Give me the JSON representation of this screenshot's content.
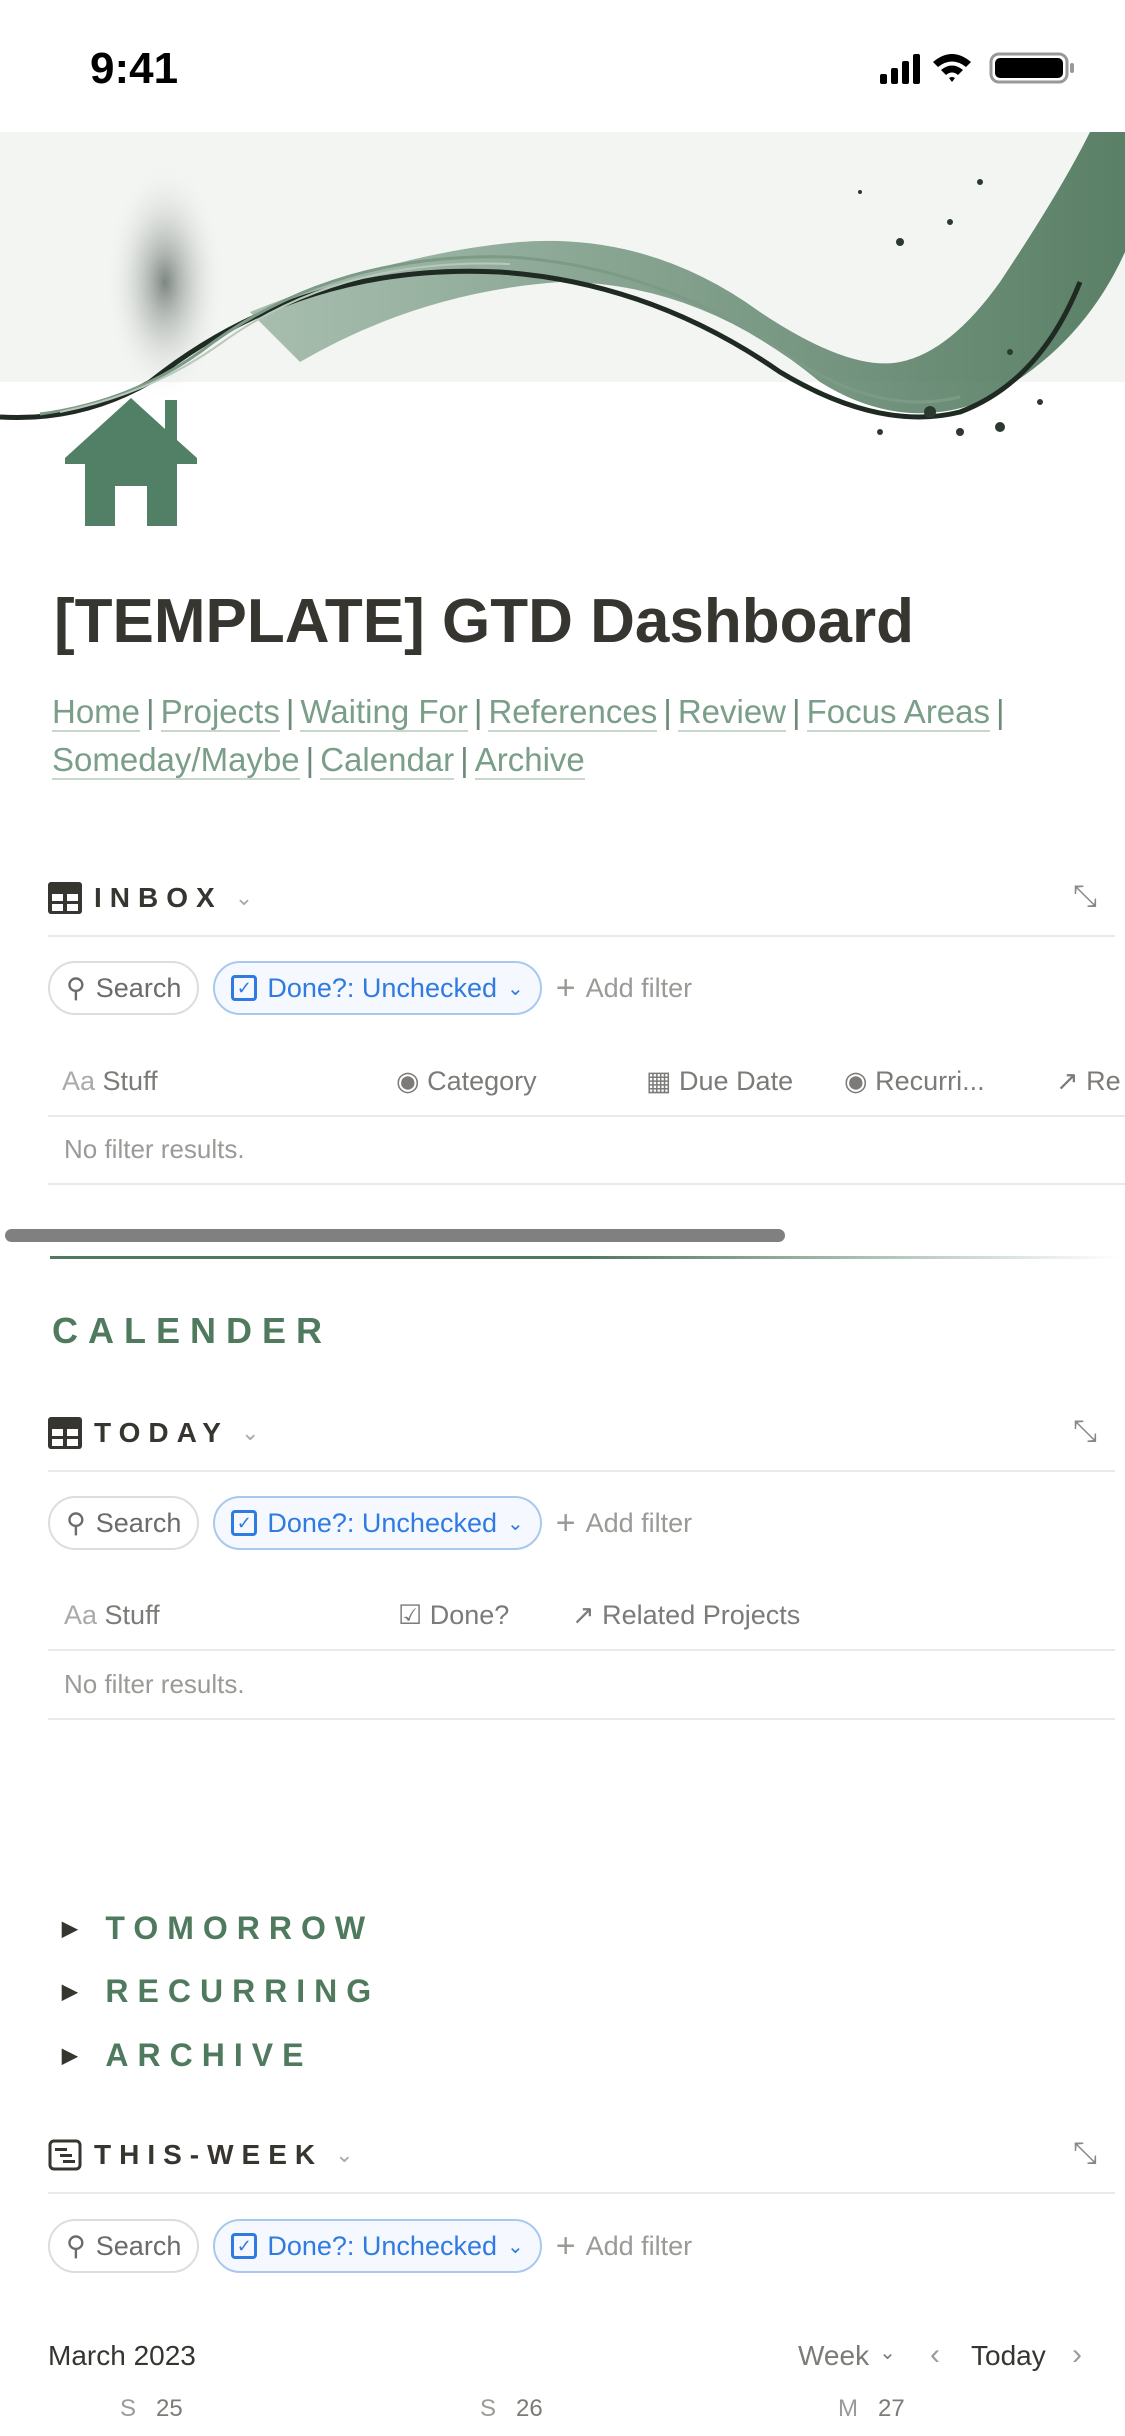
{
  "status_bar": {
    "time": "9:41"
  },
  "page": {
    "title": "[TEMPLATE] GTD Dashboard",
    "nav_links": [
      "Home",
      "Projects",
      "Waiting For",
      "References",
      "Review",
      "Focus Areas",
      "Someday/Maybe",
      "Calendar",
      "Archive"
    ],
    "accent_color": "#4f7a5e",
    "link_color": "#7a9e87"
  },
  "inbox": {
    "title": "INBOX",
    "search": "Search",
    "filter": "Done?: Unchecked",
    "add_filter": "Add filter",
    "columns": [
      "Stuff",
      "Category",
      "Due Date",
      "Recurri...",
      "Re"
    ],
    "empty": "No filter results."
  },
  "calendar_heading": "CALENDER",
  "today": {
    "title": "TODAY",
    "search": "Search",
    "filter": "Done?: Unchecked",
    "add_filter": "Add filter",
    "columns": [
      "Stuff",
      "Done?",
      "Related Projects"
    ],
    "empty": "No filter results."
  },
  "toggles": [
    "TOMORROW",
    "RECURRING",
    "ARCHIVE"
  ],
  "this_week": {
    "title": "THIS-WEEK",
    "search": "Search",
    "filter": "Done?: Unchecked",
    "add_filter": "Add filter",
    "month": "March 2023",
    "view": "Week",
    "today": "Today",
    "days": [
      {
        "dow": "S",
        "date": "25"
      },
      {
        "dow": "S",
        "date": "26"
      },
      {
        "dow": "M",
        "date": "27"
      }
    ]
  }
}
